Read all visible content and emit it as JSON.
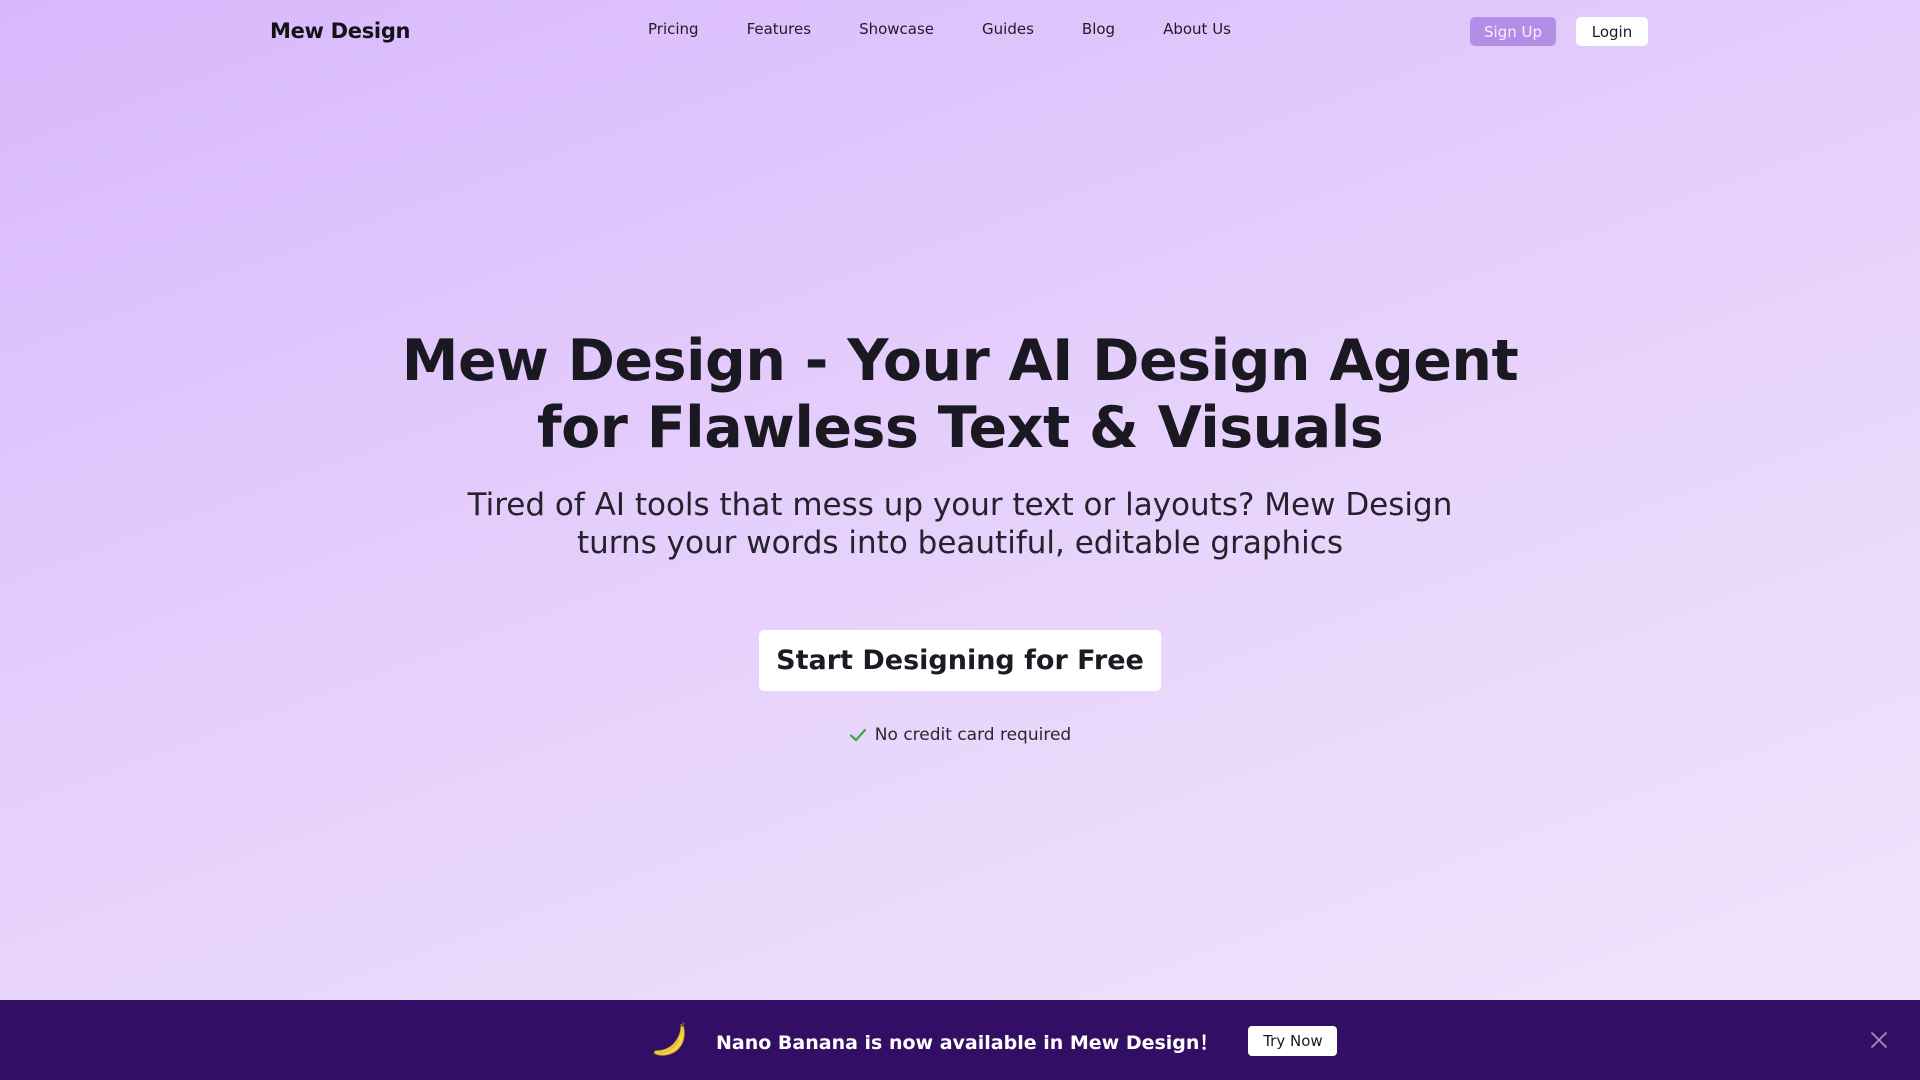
{
  "header": {
    "logo": "Mew Design",
    "nav": [
      "Pricing",
      "Features",
      "Showcase",
      "Guides",
      "Blog",
      "About Us"
    ],
    "signup_label": "Sign Up",
    "login_label": "Login"
  },
  "hero": {
    "title_line1": "Mew Design - Your AI Design Agent",
    "title_line2": "for Flawless Text & Visuals",
    "subtitle_line1": "Tired of AI tools that mess up your text or layouts? Mew Design",
    "subtitle_line2": "turns your words into beautiful, editable graphics",
    "cta_label": "Start Designing for Free",
    "note": "No credit card required"
  },
  "banner": {
    "text": "Nano Banana is now available in Mew Design！",
    "button_label": "Try Now",
    "icon": "banana-icon"
  },
  "colors": {
    "accent": "#b48ee6",
    "banner_bg": "#320f64",
    "check": "#3aa845"
  }
}
